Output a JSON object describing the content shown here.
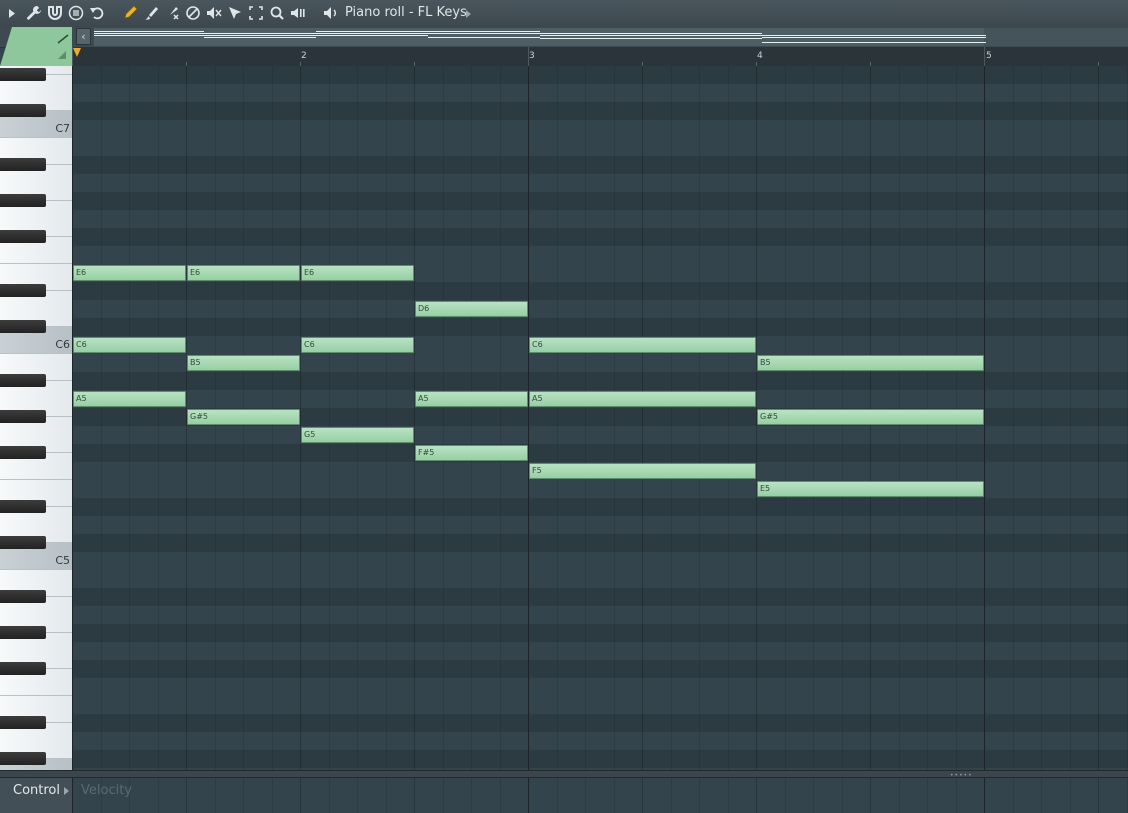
{
  "window": {
    "title": "Piano roll - FL Keys"
  },
  "toolbar": {
    "buttons": [
      {
        "name": "menu-arrow-icon"
      },
      {
        "name": "wrench-icon"
      },
      {
        "name": "magnet-icon"
      },
      {
        "name": "record-options-icon"
      },
      {
        "name": "undo-icon"
      },
      {
        "name": "pencil-icon"
      },
      {
        "name": "brush-icon"
      },
      {
        "name": "delete-tool-icon"
      },
      {
        "name": "mute-tool-icon"
      },
      {
        "name": "slice-tool-icon"
      },
      {
        "name": "select-tool-icon"
      },
      {
        "name": "zoom-tool-icon"
      },
      {
        "name": "playback-tool-icon"
      },
      {
        "name": "speaker-icon"
      }
    ]
  },
  "ruler": {
    "bars": [
      "2",
      "3",
      "4",
      "5"
    ]
  },
  "keyboard": {
    "labels": [
      "C7",
      "C6",
      "C5"
    ]
  },
  "event_editor": {
    "control_label": "Control",
    "velocity_label": "Velocity"
  },
  "colors": {
    "note": "#a8dab4",
    "grid": "#34444d",
    "playhead": "#f0a830"
  },
  "notes": [
    {
      "label": "E6",
      "pitch": 88,
      "start": 0,
      "length": 1
    },
    {
      "label": "E6",
      "pitch": 88,
      "start": 1,
      "length": 1
    },
    {
      "label": "E6",
      "pitch": 88,
      "start": 2,
      "length": 1
    },
    {
      "label": "D6",
      "pitch": 86,
      "start": 3,
      "length": 1
    },
    {
      "label": "C6",
      "pitch": 84,
      "start": 0,
      "length": 1
    },
    {
      "label": "C6",
      "pitch": 84,
      "start": 2,
      "length": 1
    },
    {
      "label": "C6",
      "pitch": 84,
      "start": 4,
      "length": 2
    },
    {
      "label": "B5",
      "pitch": 83,
      "start": 1,
      "length": 1
    },
    {
      "label": "B5",
      "pitch": 83,
      "start": 6,
      "length": 2
    },
    {
      "label": "A5",
      "pitch": 81,
      "start": 0,
      "length": 1
    },
    {
      "label": "A5",
      "pitch": 81,
      "start": 3,
      "length": 1
    },
    {
      "label": "A5",
      "pitch": 81,
      "start": 4,
      "length": 2
    },
    {
      "label": "G#5",
      "pitch": 80,
      "start": 1,
      "length": 1
    },
    {
      "label": "G#5",
      "pitch": 80,
      "start": 6,
      "length": 2
    },
    {
      "label": "G5",
      "pitch": 79,
      "start": 2,
      "length": 1
    },
    {
      "label": "F#5",
      "pitch": 78,
      "start": 3,
      "length": 1
    },
    {
      "label": "F5",
      "pitch": 77,
      "start": 4,
      "length": 2
    },
    {
      "label": "E5",
      "pitch": 76,
      "start": 6,
      "length": 2
    }
  ]
}
